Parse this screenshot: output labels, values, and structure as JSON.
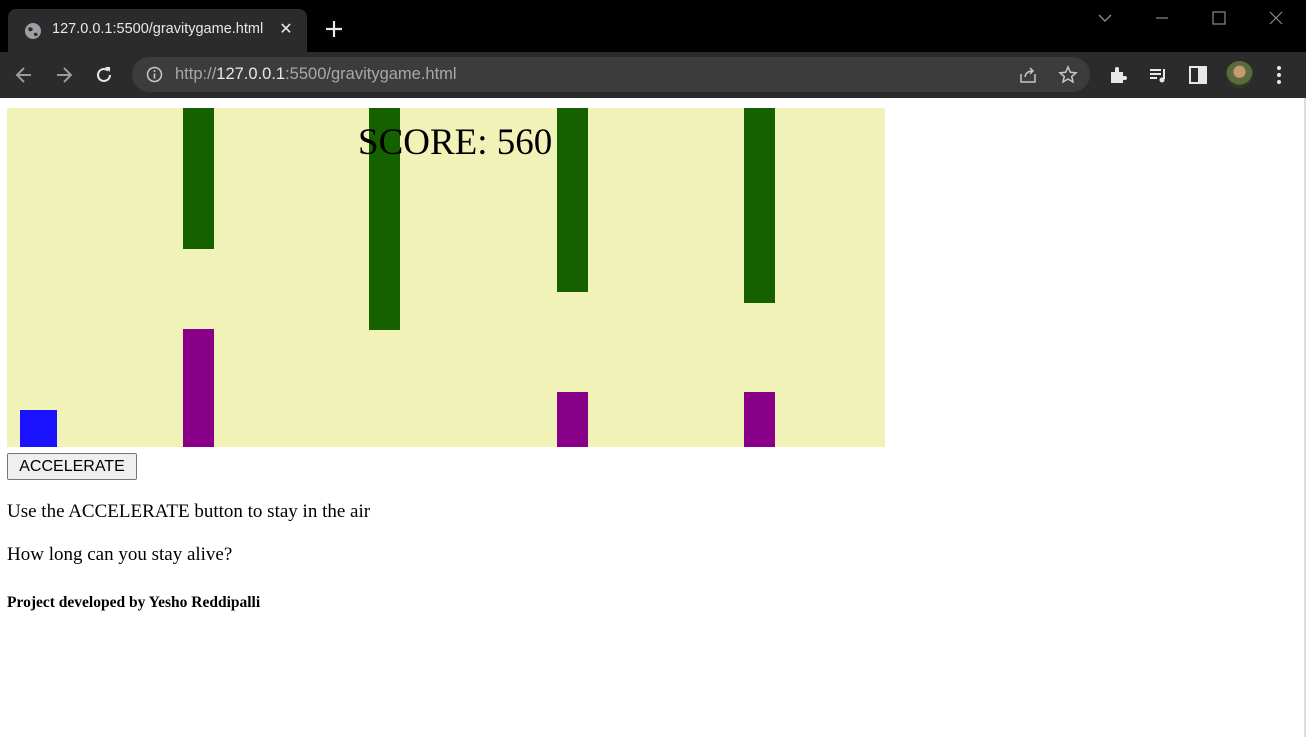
{
  "browser": {
    "tab_title": "127.0.0.1:5500/gravitygame.html",
    "url_prefix": "http://",
    "url_host": "127.0.0.1",
    "url_rest": ":5500/gravitygame.html",
    "icons": [
      "globe-icon",
      "close-icon",
      "plus-icon",
      "chevron-down-icon",
      "minimize-icon",
      "maximize-icon",
      "window-close-icon",
      "back-icon",
      "forward-icon",
      "reload-icon",
      "info-icon",
      "share-icon",
      "star-icon",
      "extensions-icon",
      "media-icon",
      "side-panel-icon",
      "avatar",
      "more-menu-icon"
    ]
  },
  "game": {
    "score_label": "SCORE: 560",
    "colors": {
      "background": "#f0f2b7",
      "top_obstacle": "#156100",
      "bottom_obstacle": "#880088",
      "player": "#1a12ff"
    }
  },
  "controls": {
    "accelerate_label": "ACCELERATE"
  },
  "content": {
    "instruction": "Use the ACCELERATE button to stay in the air",
    "question": "How long can you stay alive?",
    "credit": "Project developed by Yesho Reddipalli"
  }
}
